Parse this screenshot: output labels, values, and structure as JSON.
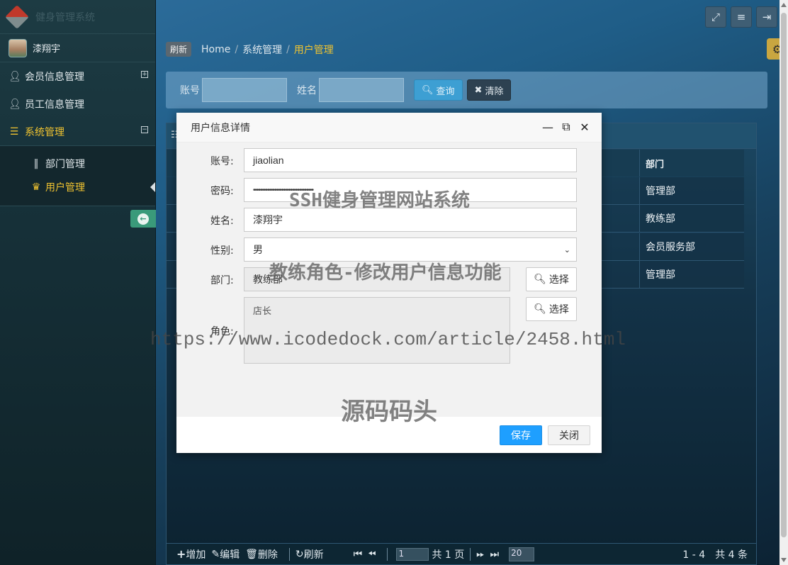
{
  "sidebar": {
    "brand_text": "健身管理系统",
    "user_name": "漆翔宇",
    "menu": [
      {
        "label": "会员信息管理",
        "icon": "user-icon",
        "toggle": "⊞"
      },
      {
        "label": "员工信息管理",
        "icon": "user-icon"
      },
      {
        "label": "系统管理",
        "icon": "list-icon",
        "toggle": "⊟",
        "active": true
      }
    ],
    "submenu": [
      {
        "label": "部门管理",
        "icon": "columns-icon"
      },
      {
        "label": "用户管理",
        "icon": "crown-icon",
        "active": true
      }
    ],
    "collapse_icon": "arrow-left-circle-icon"
  },
  "topbar": {
    "icons": [
      "fullscreen-icon",
      "menu-icon",
      "logout-icon"
    ],
    "gear_icon": "gear-icon"
  },
  "breadcrumb": {
    "refresh": "刷新",
    "items": [
      "Home",
      "系统管理",
      "用户管理"
    ]
  },
  "search": {
    "account_label": "账号",
    "name_label": "姓名",
    "query_label": "查询",
    "clear_label": "清除"
  },
  "grid": {
    "dept_header": "部门",
    "dept_values": [
      "管理部",
      "教练部",
      "会员服务部",
      "管理部"
    ],
    "pager": {
      "add": "增加",
      "edit": "编辑",
      "delete": "删除",
      "refresh": "刷新",
      "page_value": "1",
      "total_pages": "共 1 页",
      "page_size": "20",
      "summary": "1 - 4　共 4 条"
    }
  },
  "modal": {
    "title": "用户信息详情",
    "fields": {
      "account_label": "账号:",
      "account_value": "jiaolian",
      "password_label": "密码:",
      "password_value": "••••••••••••••••••••••••••••••••••",
      "name_label": "姓名:",
      "name_value": "漆翔宇",
      "gender_label": "性别:",
      "gender_value": "男",
      "dept_label": "部门:",
      "dept_value": "教练部",
      "role_label": "角色:",
      "role_value": "店长",
      "choose_label": "选择"
    },
    "save_label": "保存",
    "close_label": "关闭"
  },
  "watermarks": {
    "line1": "SSH健身管理网站系统",
    "line2": "教练角色-修改用户信息功能",
    "line3": "https://www.icodedock.com/article/2458.html",
    "line4": "源码码头"
  }
}
